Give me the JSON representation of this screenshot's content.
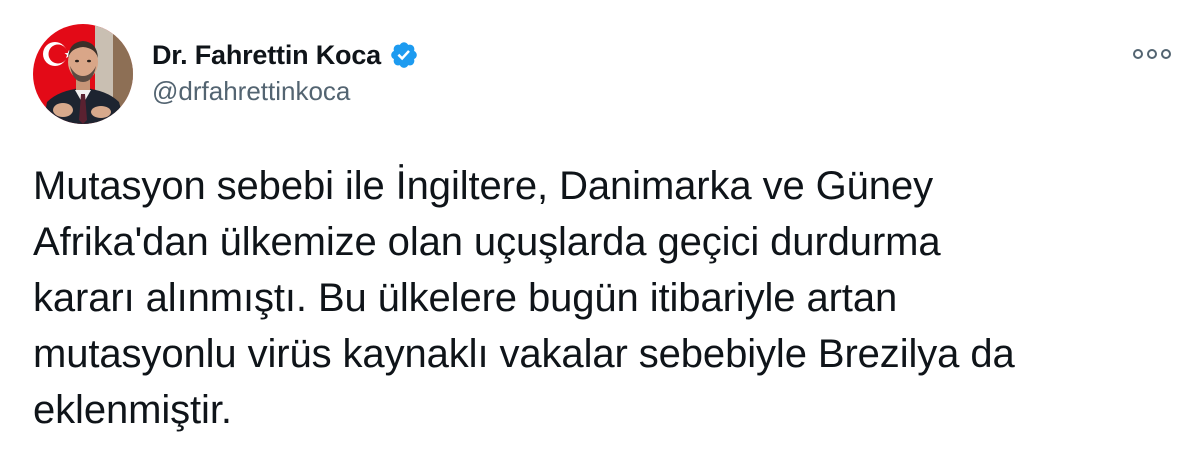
{
  "author": {
    "display_name": "Dr. Fahrettin Koca",
    "handle": "@drfahrettinkoca",
    "verified": true,
    "avatar_icon": "profile-photo"
  },
  "menu": {
    "icon": "more-options-icon"
  },
  "tweet": {
    "lines": [
      "Mutasyon sebebi ile İngiltere, Danimarka ve Güney",
      "Afrika'dan ülkemize olan uçuşlarda geçici durdurma",
      "kararı alınmıştı. Bu ülkelere bugün itibariyle artan",
      "mutasyonlu virüs kaynaklı vakalar sebebiyle Brezilya da",
      "eklenmiştir."
    ]
  },
  "colors": {
    "text_primary": "#0f1419",
    "text_secondary": "#536471",
    "verified_badge": "#1d9bf0",
    "flag_red": "#e30a17"
  }
}
